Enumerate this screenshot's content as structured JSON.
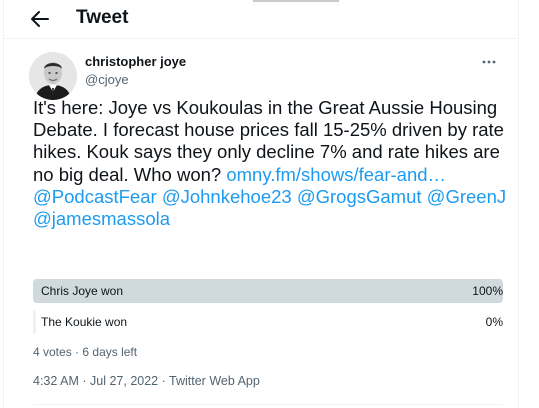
{
  "header": {
    "title": "Tweet",
    "back_icon": "arrow-left-icon"
  },
  "author": {
    "name": "christopher joye",
    "handle": "@cjoye",
    "more_icon": "more-horizontal-icon"
  },
  "tweet": {
    "text": "It's here: Joye vs Koukoulas in the Great Aussie Housing Debate. I forecast house prices fall 15-25% driven by rate hikes. Kouk says they only decline 7% and rate hikes are no big deal. Who won?",
    "links": [
      "omny.fm/shows/fear-and…",
      "@PodcastFear",
      "@Johnkehoe23",
      "@GrogsGamut",
      "@GreenJ",
      "@jamesmassola"
    ]
  },
  "poll": {
    "options": [
      {
        "label": "Chris Joye won",
        "percent_text": "100%",
        "share": 1.0
      },
      {
        "label": "The Koukie won",
        "percent_text": "0%",
        "share": 0.0
      }
    ],
    "votes": "4 votes",
    "separator": "·",
    "time_left": "6 days left"
  },
  "meta": {
    "time": "4:32 AM",
    "separator": "·",
    "date": "Jul 27, 2022",
    "source": "Twitter Web App"
  },
  "colors": {
    "link": "#1d9bf0",
    "secondary_text": "#536471",
    "poll_winner": "#cfd9de",
    "poll_loser": "#eff3f4"
  }
}
